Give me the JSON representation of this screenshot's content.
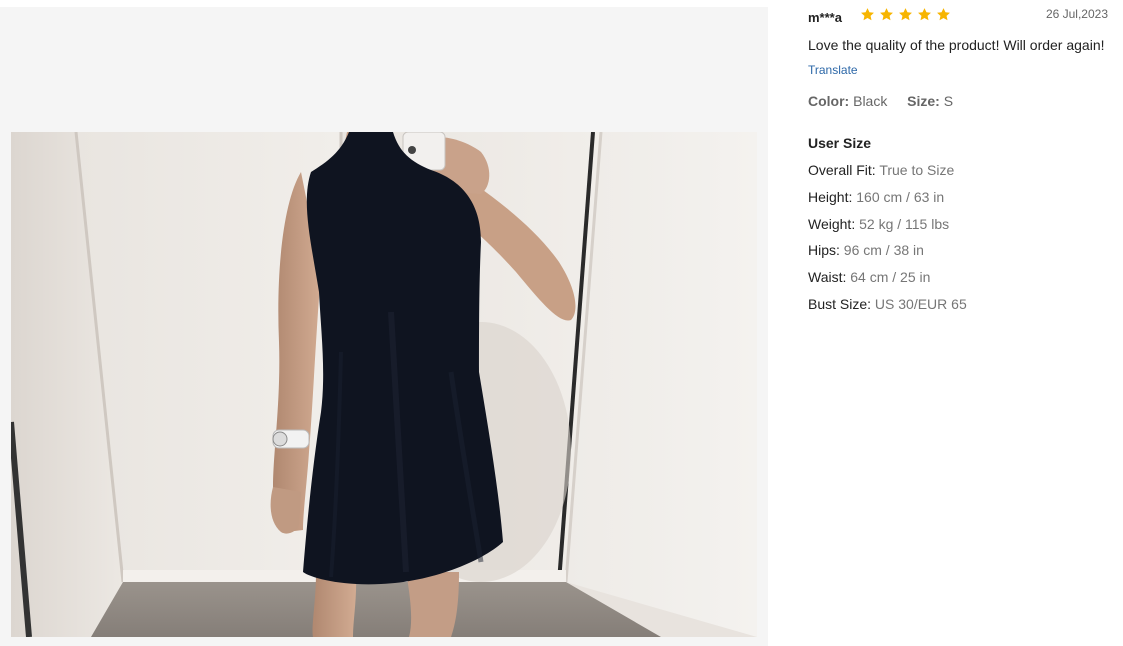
{
  "review": {
    "username": "m***a",
    "rating": 5,
    "date": "26 Jul,2023",
    "text": "Love the quality of the product! Will order again!",
    "translate_label": "Translate",
    "color_label": "Color:",
    "color_value": "Black",
    "size_label": "Size:",
    "size_value": "S"
  },
  "user_size": {
    "title": "User Size",
    "rows": [
      {
        "label": "Overall Fit: ",
        "value": "True to Size"
      },
      {
        "label": "Height: ",
        "value": "160 cm / 63 in"
      },
      {
        "label": "Weight: ",
        "value": "52 kg / 115 lbs"
      },
      {
        "label": "Hips: ",
        "value": "96 cm / 38 in"
      },
      {
        "label": "Waist: ",
        "value": "64 cm / 25 in"
      },
      {
        "label": "Bust Size: ",
        "value": "US 30/EUR 65"
      }
    ]
  },
  "colors": {
    "star": "#f7b500",
    "link": "#2d68a8",
    "dress": "#0f1420"
  },
  "icons": {
    "star": "star-icon"
  }
}
